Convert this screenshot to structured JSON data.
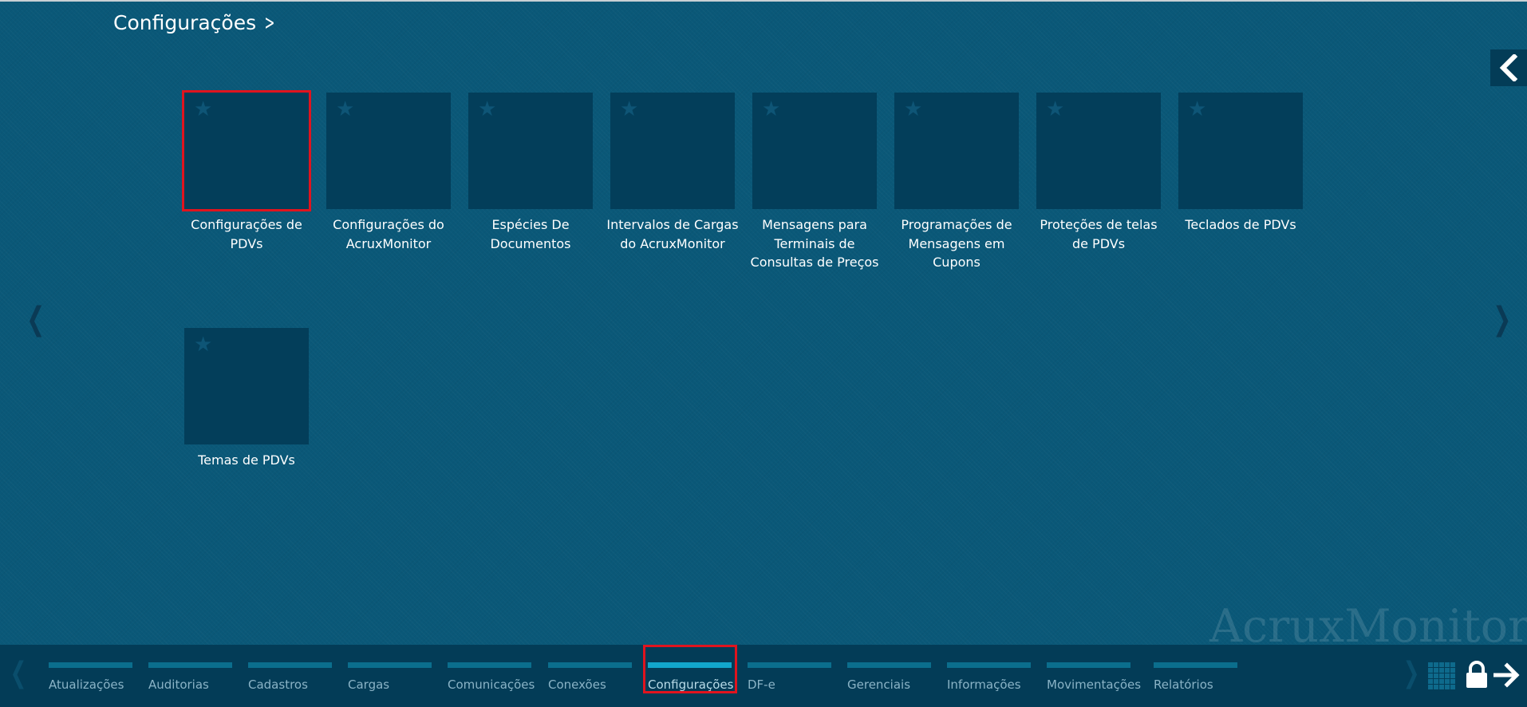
{
  "breadcrumb": {
    "title": "Configurações"
  },
  "tiles": [
    {
      "label": "Configurações de PDVs",
      "selected": true
    },
    {
      "label": "Configurações do AcruxMonitor"
    },
    {
      "label": "Espécies De Documentos"
    },
    {
      "label": "Intervalos de Cargas do AcruxMonitor"
    },
    {
      "label": "Mensagens para Terminais de Consultas de Preços"
    },
    {
      "label": "Programações de Mensagens em Cupons"
    },
    {
      "label": "Proteções de telas de PDVs"
    },
    {
      "label": "Teclados de PDVs"
    },
    {
      "label": "Temas de PDVs"
    }
  ],
  "watermark": "AcruxMonitor",
  "taskbar": {
    "items": [
      {
        "label": "Atualizações"
      },
      {
        "label": "Auditorias"
      },
      {
        "label": "Cadastros"
      },
      {
        "label": "Cargas"
      },
      {
        "label": "Comunicações"
      },
      {
        "label": "Conexões"
      },
      {
        "label": "Configurações",
        "active": true
      },
      {
        "label": "DF-e"
      },
      {
        "label": "Gerenciais"
      },
      {
        "label": "Informações"
      },
      {
        "label": "Movimentações"
      },
      {
        "label": "Relatórios"
      }
    ]
  },
  "icons": {
    "collapse": "chevron-left-icon",
    "prev": "chevron-left-icon",
    "next": "chevron-right-icon",
    "apps": "grid-icon",
    "lock": "lock-icon",
    "logout": "arrow-right-icon"
  },
  "colors": {
    "background": "#0a5878",
    "tile": "#033e5a",
    "taskbar": "#033c57",
    "accent": "#12a7cc",
    "selection": "#e0141e"
  }
}
